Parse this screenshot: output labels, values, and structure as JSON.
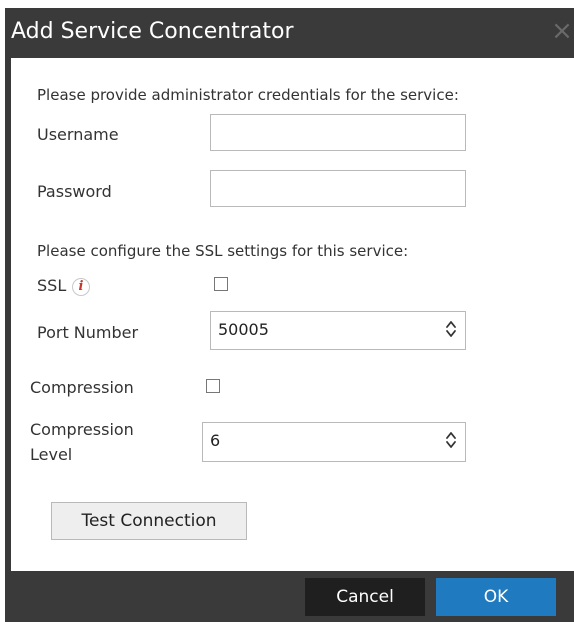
{
  "dialog": {
    "title": "Add Service Concentrator",
    "close_symbol": "×"
  },
  "credentials": {
    "intro": "Please provide administrator credentials for the service:",
    "username_label": "Username",
    "username_value": "",
    "password_label": "Password",
    "password_value": ""
  },
  "ssl": {
    "intro": "Please configure the SSL settings for this service:",
    "ssl_label": "SSL",
    "info_icon": "info-icon",
    "ssl_checked": false,
    "port_label": "Port Number",
    "port_value": "50005"
  },
  "compression": {
    "label": "Compression",
    "checked": false,
    "level_label_line1": "Compression",
    "level_label_line2": "Level",
    "level_value": "6"
  },
  "buttons": {
    "test_connection": "Test Connection",
    "cancel": "Cancel",
    "ok": "OK"
  },
  "colors": {
    "titlebar": "#3a3a3a",
    "ok_button": "#1f7ac0",
    "cancel_button": "#1f1f1f",
    "info_icon": "#c0392b"
  }
}
